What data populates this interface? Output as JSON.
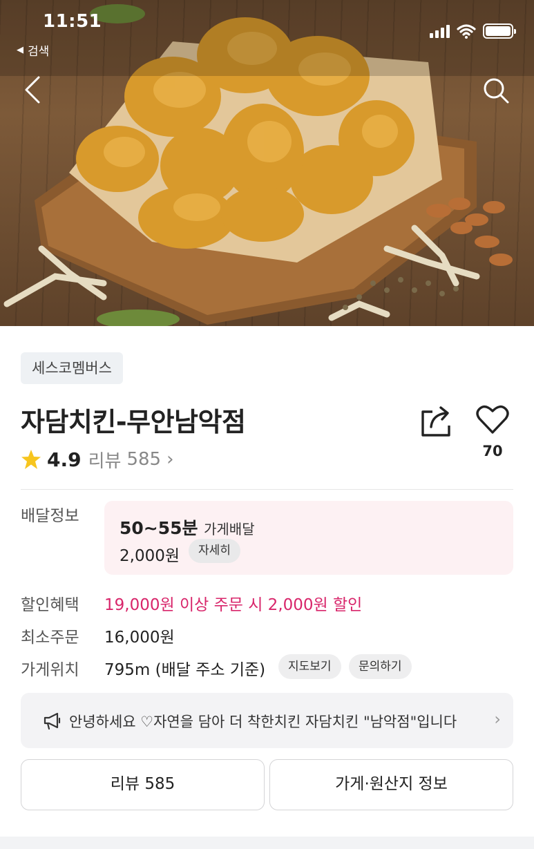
{
  "status_bar": {
    "time": "11:51",
    "back_app": "검색"
  },
  "hero": {
    "image_alt": "fried chicken on wooden board"
  },
  "store": {
    "category_tag": "세스코멤버스",
    "name": "자담치킨-무안남악점",
    "rating": "4.9",
    "review_label": "리뷰",
    "review_count": "585",
    "like_count": "70"
  },
  "info": {
    "delivery": {
      "label": "배달정보",
      "time": "50~55분",
      "type": "가게배달",
      "fee": "2,000원",
      "detail_button": "자세히"
    },
    "discount": {
      "label": "할인혜택",
      "value": "19,000원 이상 주문 시 2,000원 할인"
    },
    "min_order": {
      "label": "최소주문",
      "value": "16,000원"
    },
    "location": {
      "label": "가게위치",
      "value": "795m (배달 주소 기준)",
      "map_button": "지도보기",
      "inquiry_button": "문의하기"
    }
  },
  "notice": {
    "icon": "megaphone-icon",
    "text": "안녕하세요 ♡자연을 담아 더 착한치킨 자담치킨 \"남악점\"입니다"
  },
  "buttons": {
    "reviews": "리뷰 585",
    "store_info": "가게·원산지 정보"
  },
  "colors": {
    "accent_pink": "#d8256a",
    "delivery_bg": "#fdf1f3",
    "star": "#f7c51e"
  }
}
